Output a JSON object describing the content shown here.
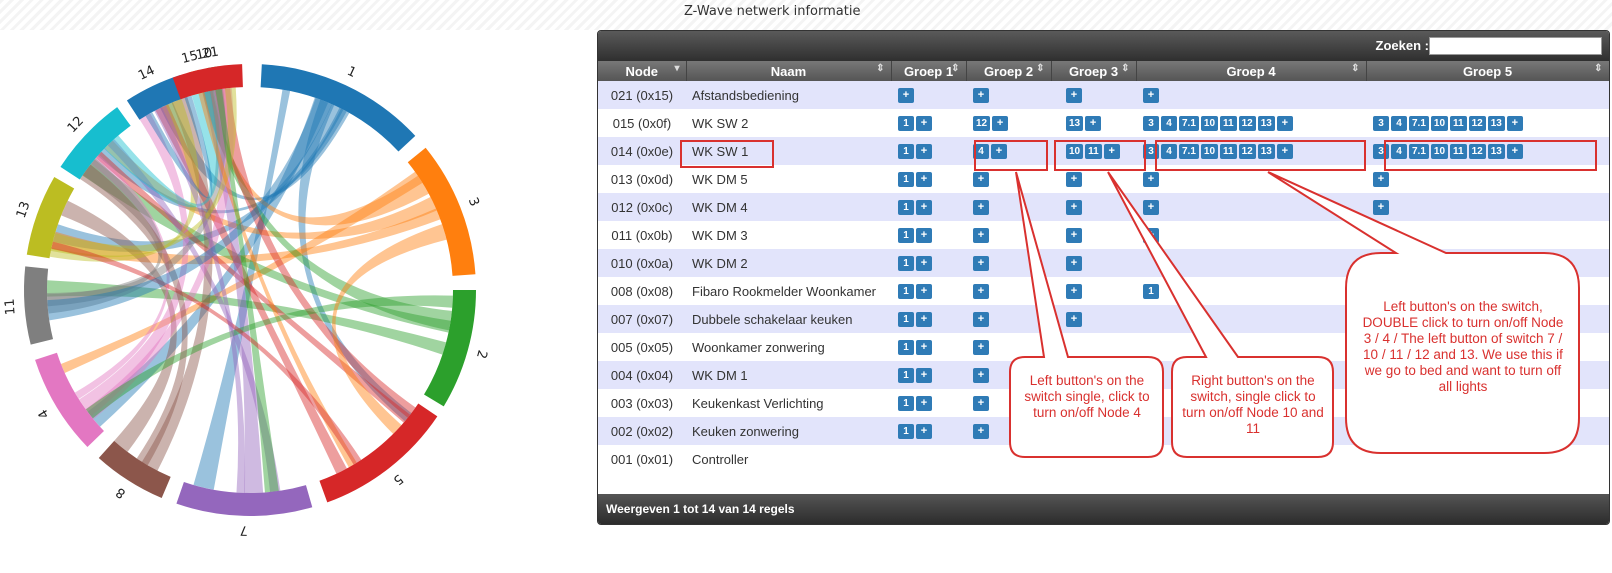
{
  "page_title": "Z-Wave netwerk informatie",
  "chord": {
    "groups": [
      {
        "label": "1",
        "color": "#1f77b4"
      },
      {
        "label": "3",
        "color": "#ff7f0e"
      },
      {
        "label": "2",
        "color": "#2ca02c"
      },
      {
        "label": "5",
        "color": "#d62728"
      },
      {
        "label": "7",
        "color": "#9467bd"
      },
      {
        "label": "8",
        "color": "#8c564b"
      },
      {
        "label": "4",
        "color": "#e377c2"
      },
      {
        "label": "11",
        "color": "#7f7f7f"
      },
      {
        "label": "13",
        "color": "#bcbd22"
      },
      {
        "label": "12",
        "color": "#17becf"
      },
      {
        "label": "14",
        "color": "#1f77b4"
      },
      {
        "label": "15",
        "color": "#ff7f0e"
      },
      {
        "label": "21",
        "color": "#2ca02c"
      },
      {
        "label": "10",
        "color": "#d62728"
      }
    ]
  },
  "search": {
    "label": "Zoeken :",
    "value": ""
  },
  "columns": [
    "Node",
    "Naam",
    "Groep 1",
    "Groep 2",
    "Groep 3",
    "Groep 4",
    "Groep 5"
  ],
  "rows": [
    {
      "node": "021 (0x15)",
      "name": "Afstandsbediening",
      "g1": [
        "+"
      ],
      "g2": [
        "+"
      ],
      "g3": [
        "+"
      ],
      "g4": [
        "+"
      ],
      "g5": []
    },
    {
      "node": "015 (0x0f)",
      "name": "WK SW 2",
      "g1": [
        "1",
        "+"
      ],
      "g2": [
        "12",
        "+"
      ],
      "g3": [
        "13",
        "+"
      ],
      "g4": [
        "3",
        "4",
        "7.1",
        "10",
        "11",
        "12",
        "13",
        "+"
      ],
      "g5": [
        "3",
        "4",
        "7.1",
        "10",
        "11",
        "12",
        "13",
        "+"
      ]
    },
    {
      "node": "014 (0x0e)",
      "name": "WK SW 1",
      "g1": [
        "1",
        "+"
      ],
      "g2": [
        "4",
        "+"
      ],
      "g3": [
        "10",
        "11",
        "+"
      ],
      "g4": [
        "3",
        "4",
        "7.1",
        "10",
        "11",
        "12",
        "13",
        "+"
      ],
      "g5": [
        "3",
        "4",
        "7.1",
        "10",
        "11",
        "12",
        "13",
        "+"
      ]
    },
    {
      "node": "013 (0x0d)",
      "name": "WK DM 5",
      "g1": [
        "1",
        "+"
      ],
      "g2": [
        "+"
      ],
      "g3": [
        "+"
      ],
      "g4": [
        "+"
      ],
      "g5": [
        "+"
      ]
    },
    {
      "node": "012 (0x0c)",
      "name": "WK DM 4",
      "g1": [
        "1",
        "+"
      ],
      "g2": [
        "+"
      ],
      "g3": [
        "+"
      ],
      "g4": [
        "+"
      ],
      "g5": [
        "+"
      ]
    },
    {
      "node": "011 (0x0b)",
      "name": "WK DM 3",
      "g1": [
        "1",
        "+"
      ],
      "g2": [
        "+"
      ],
      "g3": [
        "+"
      ],
      "g4": [
        "+"
      ],
      "g5": []
    },
    {
      "node": "010 (0x0a)",
      "name": "WK DM 2",
      "g1": [
        "1",
        "+"
      ],
      "g2": [
        "+"
      ],
      "g3": [
        "+"
      ],
      "g4": [],
      "g5": []
    },
    {
      "node": "008 (0x08)",
      "name": "Fibaro Rookmelder Woonkamer",
      "g1": [
        "1",
        "+"
      ],
      "g2": [
        "+"
      ],
      "g3": [
        "+"
      ],
      "g4": [
        "1"
      ],
      "g5": []
    },
    {
      "node": "007 (0x07)",
      "name": "Dubbele schakelaar keuken",
      "g1": [
        "1",
        "+"
      ],
      "g2": [
        "+"
      ],
      "g3": [
        "+"
      ],
      "g4": [],
      "g5": []
    },
    {
      "node": "005 (0x05)",
      "name": "Woonkamer zonwering",
      "g1": [
        "1",
        "+"
      ],
      "g2": [
        "+"
      ],
      "g3": [],
      "g4": [],
      "g5": []
    },
    {
      "node": "004 (0x04)",
      "name": "WK DM 1",
      "g1": [
        "1",
        "+"
      ],
      "g2": [
        "+"
      ],
      "g3": [],
      "g4": [],
      "g5": []
    },
    {
      "node": "003 (0x03)",
      "name": "Keukenkast Verlichting",
      "g1": [
        "1",
        "+"
      ],
      "g2": [
        "+"
      ],
      "g3": [],
      "g4": [],
      "g5": []
    },
    {
      "node": "002 (0x02)",
      "name": "Keuken zonwering",
      "g1": [
        "1",
        "+"
      ],
      "g2": [
        "+"
      ],
      "g3": [],
      "g4": [],
      "g5": []
    },
    {
      "node": "001 (0x01)",
      "name": "Controller",
      "g1": [],
      "g2": [],
      "g3": [],
      "g4": [],
      "g5": []
    }
  ],
  "footer": "Weergeven 1 tot 14 van 14 regels",
  "annotations": [
    {
      "text": "Left button's on the switch single, click to turn on/off Node 4"
    },
    {
      "text": "Right button's on the switch, single click to turn on/off Node 10 and 11"
    },
    {
      "text": "Left button's on the switch, DOUBLE click to turn on/off Node 3 / 4 / The left button of switch 7 / 10 / 11 / 12 and 13. We use this if we go to bed and want to turn off all lights"
    }
  ],
  "colors": {
    "accent": "#2f7bb6",
    "annotation": "#d9312f",
    "row_alt": "#e2e4fb"
  }
}
